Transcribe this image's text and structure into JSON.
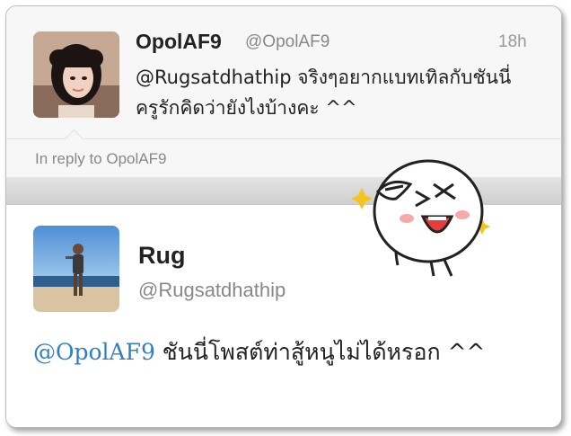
{
  "tweet_top": {
    "display_name": "OpolAF9",
    "handle": "@OpolAF9",
    "time": "18h",
    "text": "@Rugsatdhathip จริงๆอยากแบทเทิลกับชันนี่ ครูรักคิดว่ายังไงบ้างคะ ^^",
    "reply_context": "In reply to OpolAF9"
  },
  "tweet_main": {
    "display_name": "Rug",
    "handle": "@Rugsatdhathip",
    "mention": "@OpolAF9",
    "text": " ชันนี่โพสต์ท่าสู้หนูไม่ได้หรอก ^^"
  },
  "colors": {
    "mention_blue": "#2f7fc1",
    "handle_gray": "#888888"
  },
  "icons": {
    "sticker": "winking-cartoon-character-sticker"
  }
}
